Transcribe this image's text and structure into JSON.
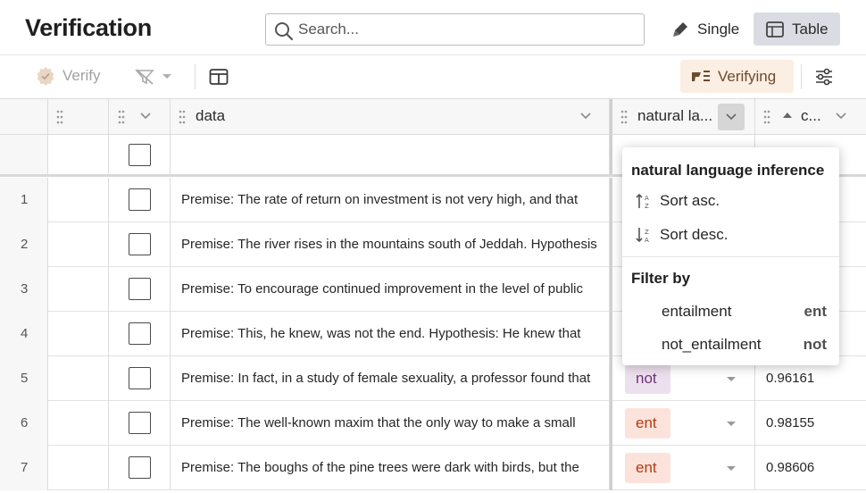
{
  "header": {
    "title": "Verification",
    "search_placeholder": "Search...",
    "mode_single": "Single",
    "mode_table": "Table"
  },
  "toolbar": {
    "verify_label": "Verify",
    "verifying_label": "Verifying"
  },
  "columns": {
    "data": "data",
    "label": "natural la...",
    "confidence": "c..."
  },
  "rows": [
    {
      "num": "1",
      "data": "Premise: The rate of return on investment is not very high, and that",
      "tag": "",
      "tag_kind": "",
      "conf": ""
    },
    {
      "num": "2",
      "data": "Premise: The river rises in the mountains south of Jeddah. Hypothesis",
      "tag": "",
      "tag_kind": "",
      "conf": ""
    },
    {
      "num": "3",
      "data": "Premise: To encourage continued improvement in the level of public",
      "tag": "",
      "tag_kind": "",
      "conf": ""
    },
    {
      "num": "4",
      "data": "Premise: This, he knew, was not the end. Hypothesis: He knew that",
      "tag": "",
      "tag_kind": "",
      "conf": ""
    },
    {
      "num": "5",
      "data": "Premise: In fact, in a study of female sexuality, a professor found that",
      "tag": "not",
      "tag_kind": "not",
      "conf": "0.96161"
    },
    {
      "num": "6",
      "data": "Premise: The well-known maxim that the only way to make a small",
      "tag": "ent",
      "tag_kind": "ent",
      "conf": "0.98155"
    },
    {
      "num": "7",
      "data": "Premise: The boughs of the pine trees were dark with birds, but the",
      "tag": "ent",
      "tag_kind": "ent",
      "conf": "0.98606"
    }
  ],
  "popup": {
    "title": "natural language inference",
    "sort_asc": "Sort asc.",
    "sort_desc": "Sort desc.",
    "filter_by": "Filter by",
    "options": [
      {
        "label": "entailment",
        "abbr": "ent"
      },
      {
        "label": "not_entailment",
        "abbr": "not"
      }
    ]
  },
  "colors": {
    "ent_bg": "#fbe3dc",
    "ent_text": "#b43b12",
    "not_bg": "#ede0ee",
    "not_text": "#6c3478",
    "verifying_bg": "#fbeee3",
    "active_mode_bg": "#d9dde3"
  },
  "icons": [
    "search-icon",
    "pen-icon",
    "table-icon",
    "verify-badge-icon",
    "filter-off-icon",
    "columns-layout-icon",
    "verifying-icon",
    "settings-sliders-icon",
    "grip-icon",
    "chevron-down-icon",
    "sort-asc-icon",
    "sort-desc-icon"
  ]
}
